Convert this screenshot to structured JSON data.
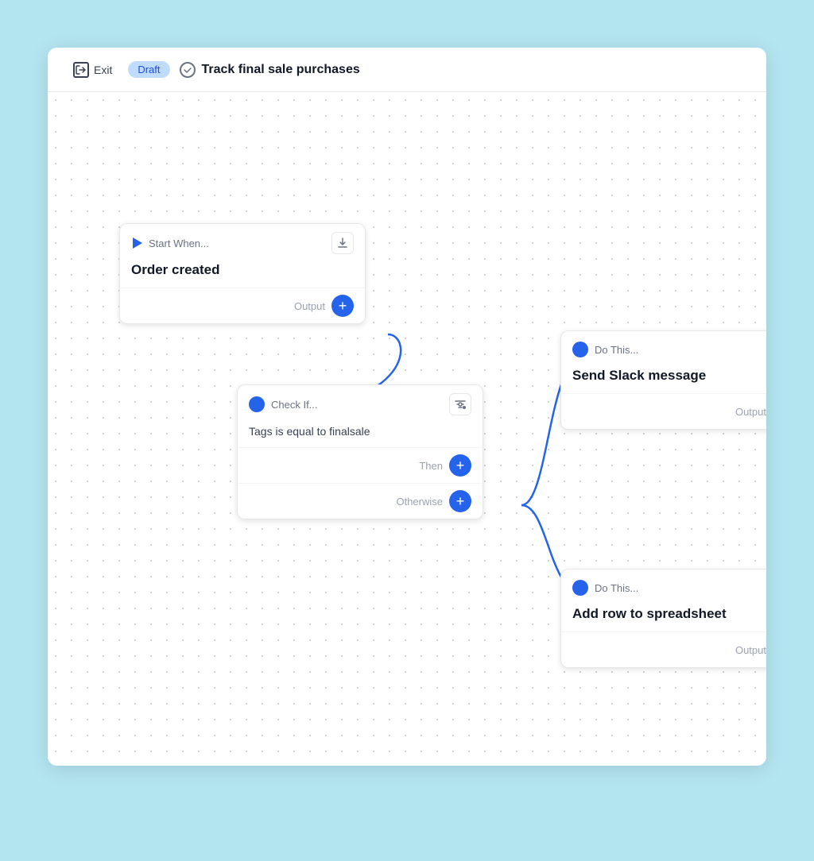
{
  "header": {
    "exit_label": "Exit",
    "draft_label": "Draft",
    "check_icon": "✓",
    "title": "Track final sale purchases"
  },
  "canvas": {
    "nodes": {
      "start": {
        "label": "Start When...",
        "title": "Order created",
        "output_label": "Output",
        "download_icon": "⬇"
      },
      "check": {
        "label": "Check If...",
        "condition": "Tags is equal to finalsale",
        "then_label": "Then",
        "otherwise_label": "Otherwise",
        "filter_icon": "⚙"
      },
      "do_slack": {
        "label": "Do This...",
        "title": "Send Slack message",
        "output_label": "Output"
      },
      "do_sheets": {
        "label": "Do This...",
        "title": "Add row to spreadsheet",
        "output_label": "Output"
      }
    }
  }
}
